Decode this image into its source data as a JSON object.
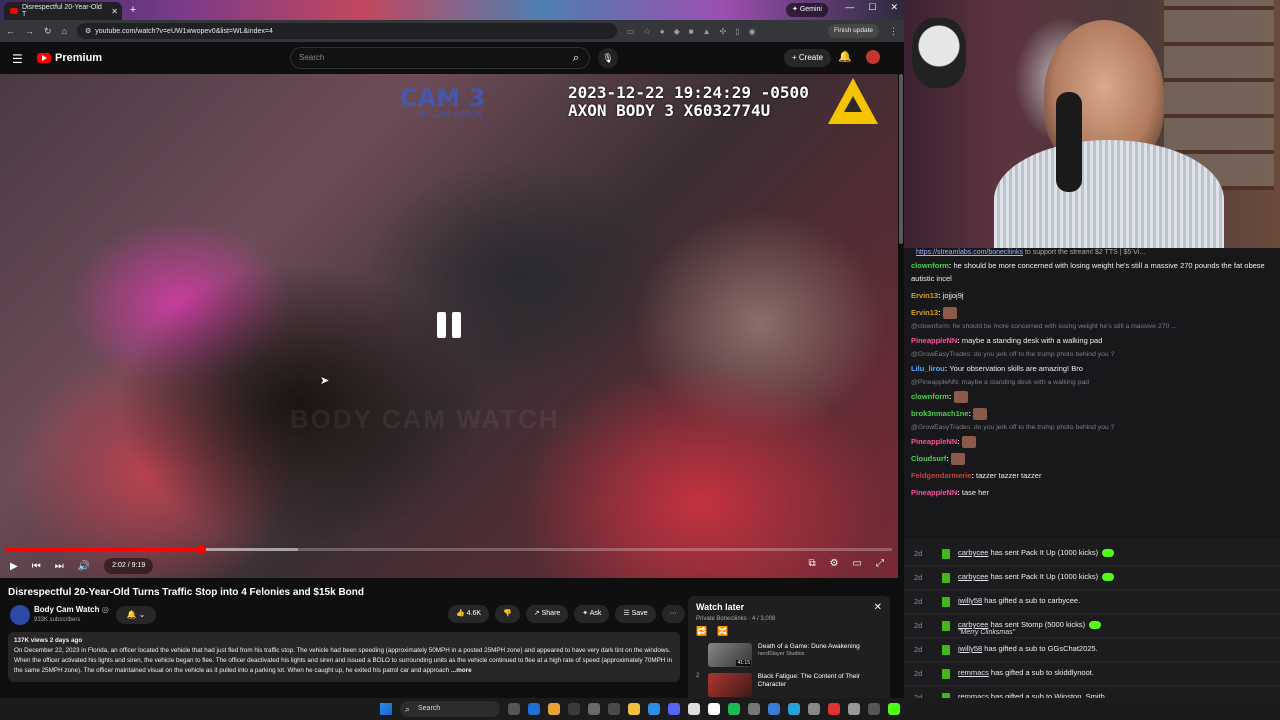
{
  "browser": {
    "tab_title": "Disrespectful 20-Year-Old T",
    "new_tab": "+",
    "gemini_label": "Gemini",
    "url": "youtube.com/watch?v=eUW1wwopev0&list=WL&index=4",
    "finish_update": "Finish update"
  },
  "youtube": {
    "logo_text": "Premium",
    "search_placeholder": "Search",
    "create_label": "Create"
  },
  "video": {
    "cam_label": "CAM 3",
    "cam_sub": "BY CAM WATCH",
    "timestamp_line1": "2023-12-22 19:24:29 -0500",
    "timestamp_line2": "AXON BODY 3 X6032774U",
    "watermark": "BODY CAM WATCH",
    "time": "2:02 / 9:19",
    "progress_played_fraction": 0.22,
    "progress_loaded_fraction": 0.33
  },
  "meta": {
    "title": "Disrespectful 20-Year-Old Turns Traffic Stop into 4 Felonies and $15k Bond",
    "channel": "Body Cam Watch",
    "verified": "◎",
    "subs": "933K subscribers",
    "likes": "4.6K",
    "share": "Share",
    "ask": "Ask",
    "save": "Save",
    "more": "···",
    "views_date": "137K views  2 days ago",
    "description": "On December 22, 2023 in Florida, an officer located the vehicle that had just fled from his traffic stop. The vehicle had been speeding (approximately 50MPH in a posted 25MPH zone) and appeared to have very dark tint on the windows. When the officer activated his lights and siren, the vehicle began to flee. The officer deactivated his lights and siren and issued a BOLO to surrounding units as the vehicle continued to flee at a high rate of speed (approximately 70MPH in the same 25MPH zone). The officer maintained visual on the vehicle as it pulled into a parking lot. When he caught up, he exited his patrol car and approach",
    "desc_more": "...more"
  },
  "watch_later": {
    "title": "Watch later",
    "sub": "Private  Bonecliinks · 4 / 3,008",
    "items": [
      {
        "idx": "",
        "title": "Death of a Game: Dune Awakening",
        "channel": "nerdSlayer Studios",
        "duration": "41:15"
      },
      {
        "idx": "2",
        "title": "Black Fatigue: The Content of Their Character",
        "channel": "",
        "duration": ""
      }
    ]
  },
  "chat": {
    "pinned_link": "https://streamlabs.com/bonecliinks",
    "pinned_rest": " to support the stream! $2 TTS | $5 Vi...",
    "messages": [
      {
        "user": "clownform",
        "color": "#4fcf4f",
        "text": "he should be more concerned with losing weight he's still a massive 270 pounds the fat obese autistic incel"
      },
      {
        "user": "Ervin13",
        "color": "#d4a017",
        "text": "jojjoj9j"
      },
      {
        "user": "Ervin13",
        "color": "#d4a017",
        "text": ""
      },
      {
        "reply": "@clownform: he should be more concerned with losing weight he's still a massive 270 ...",
        "user": "PineappleNN",
        "color": "#ff4fa0",
        "text": "maybe a standing desk with a walking pad"
      },
      {
        "reply": "@GrowEasyTrades: do you jerk off to the trump photo behind you ?",
        "user": "Lilu_lirou",
        "color": "#5aa8ff",
        "text": "Your observation skills are amazing! Bro"
      },
      {
        "reply": "@PineappleNN: maybe a standing desk with a walking pad",
        "user": "clownform",
        "color": "#4fcf4f",
        "text": ""
      },
      {
        "user": "brok3nmach1ne",
        "color": "#4fcf4f",
        "text": ""
      },
      {
        "reply": "@GrowEasyTrades: do you jerk off to the trump photo behind you ?",
        "user": "PineappleNN",
        "color": "#ff4fa0",
        "text": ""
      },
      {
        "user": "Cloudsurf",
        "color": "#4fcf4f",
        "text": ""
      },
      {
        "user": "Feldgendarmerie",
        "color": "#c94040",
        "text": "tazzer tazzer tazzer"
      },
      {
        "user": "PineappleNN",
        "color": "#ff4fa0",
        "text": "tase her"
      }
    ]
  },
  "alerts": [
    {
      "time": "2d",
      "user": "carbycee",
      "text": " has sent Pack It Up (1000 kicks)",
      "quote": "",
      "pill": true
    },
    {
      "time": "2d",
      "user": "carbycee",
      "text": " has sent Pack It Up (1000 kicks)",
      "quote": "",
      "pill": true
    },
    {
      "time": "2d",
      "user": "jwilly58",
      "text": " has gifted a sub to carbycee.",
      "quote": "",
      "pill": false
    },
    {
      "time": "2d",
      "user": "carbycee",
      "text": " has sent Stomp (5000 kicks)",
      "quote": "\"Merry Clinksmas\"",
      "pill": true
    },
    {
      "time": "2d",
      "user": "jwilly58",
      "text": " has gifted a sub to GGsChat2025.",
      "quote": "",
      "pill": false
    },
    {
      "time": "2d",
      "user": "remmacs",
      "text": " has gifted a sub to skiddlynoot.",
      "quote": "",
      "pill": false
    },
    {
      "time": "2d",
      "user": "remmacs",
      "text": " has gifted a sub to Winston_Smith.",
      "quote": "",
      "pill": false
    }
  ],
  "taskbar": {
    "search": "Search"
  },
  "colors": {
    "yt_red": "#ff0000",
    "kick_green": "#53fc18"
  }
}
